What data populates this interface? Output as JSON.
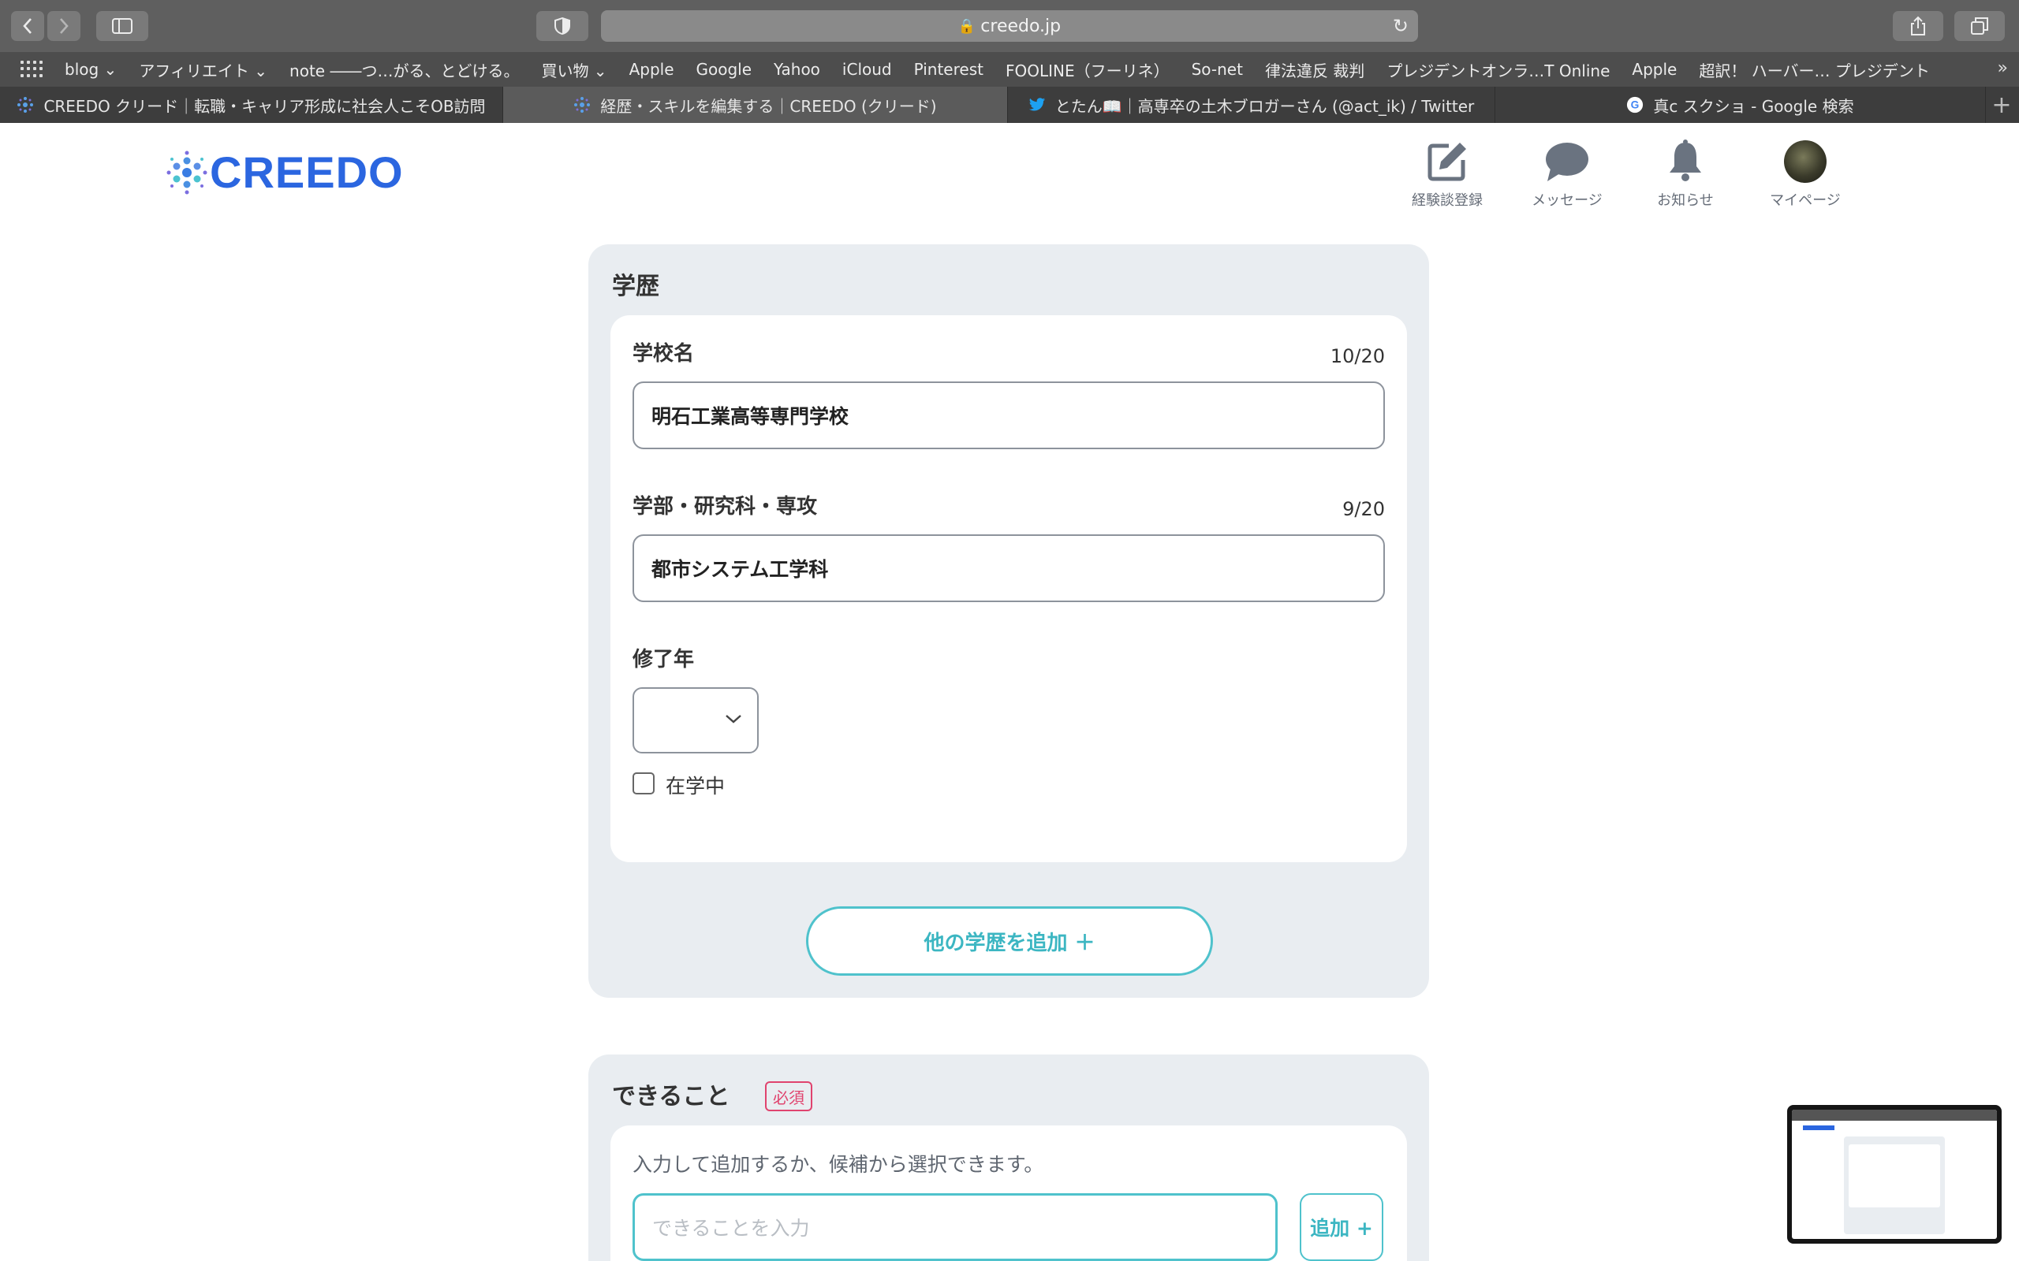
{
  "browser": {
    "url": "creedo.jp",
    "bookmarks": [
      "blog ⌄",
      "アフィリエイト ⌄",
      "note ――つ…がる、とどける。",
      "買い物 ⌄",
      "Apple",
      "Google",
      "Yahoo",
      "iCloud",
      "Pinterest",
      "FOOLINE（フーリネ）",
      "So-net",
      "律法違反 裁判",
      "プレジデントオンラ…T Online",
      "Apple",
      "超訳！ ハーバー… プレジデント"
    ],
    "tabs": [
      {
        "title": "CREEDO クリード｜転職・キャリア形成に社会人こそOB訪問",
        "icon": "creedo-favicon-icon"
      },
      {
        "title": "経歴・スキルを編集する｜CREEDO (クリード)",
        "icon": "creedo-favicon-icon"
      },
      {
        "title": "とたん📖｜高専卒の土木ブロガーさん (@act_ik) / Twitter",
        "icon": "twitter-icon"
      },
      {
        "title": "真c スクショ - Google 検索",
        "icon": "google-icon"
      }
    ]
  },
  "header": {
    "logo": "CREEDO",
    "nav": [
      {
        "label": "経験談登録",
        "icon": "edit-icon"
      },
      {
        "label": "メッセージ",
        "icon": "chat-bubble-icon"
      },
      {
        "label": "お知らせ",
        "icon": "bell-icon"
      },
      {
        "label": "マイページ",
        "icon": "avatar"
      }
    ]
  },
  "education": {
    "title": "学歴",
    "school": {
      "label": "学校名",
      "count": "10/20",
      "value": "明石工業高等専門学校"
    },
    "faculty": {
      "label": "学部・研究科・専攻",
      "count": "9/20",
      "value": "都市システム工学科"
    },
    "graduation": {
      "label": "修了年",
      "value": ""
    },
    "enrolled_label": "在学中",
    "add_button": "他の学歴を追加 ＋"
  },
  "skills": {
    "title": "できること",
    "required_badge": "必須",
    "hint": "入力して追加するか、候補から選択できます。",
    "placeholder": "できることを入力",
    "add_button": "追加 +"
  },
  "colors": {
    "accent": "#4fc2cc",
    "brand": "#2b66e0",
    "required": "#e0436e"
  }
}
